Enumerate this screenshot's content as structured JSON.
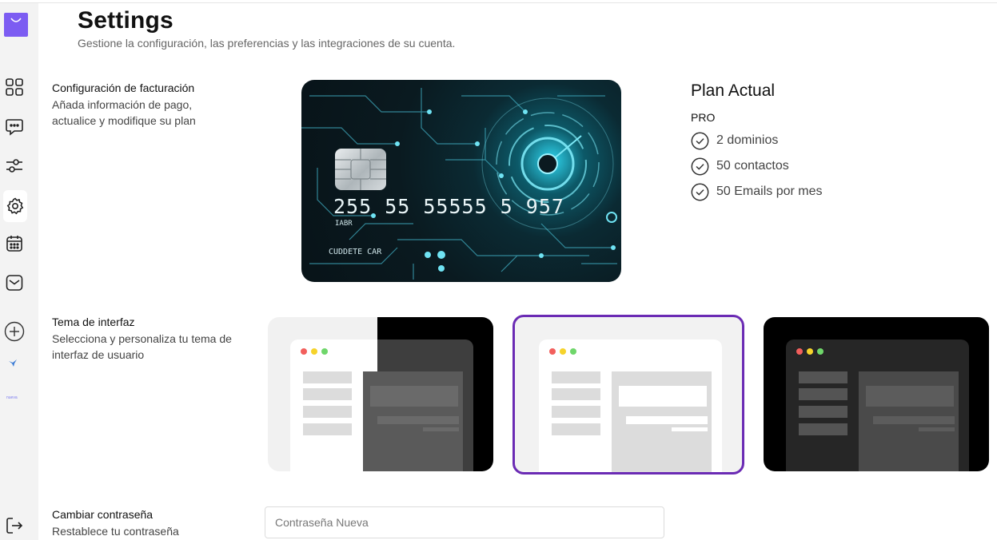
{
  "header": {
    "title": "Settings",
    "subtitle": "Gestione la configuración, las preferencias y las integraciones de su cuenta."
  },
  "sidebar": {
    "items": [
      {
        "icon": "dashboard-icon"
      },
      {
        "icon": "chat-icon"
      },
      {
        "icon": "sliders-icon"
      },
      {
        "icon": "gear-icon",
        "active": true
      },
      {
        "icon": "calendar-icon"
      },
      {
        "icon": "mail-icon"
      },
      {
        "icon": "plus-icon"
      }
    ],
    "tiny_label": "nueva",
    "logout_icon": "logout-icon"
  },
  "billing": {
    "title": "Configuración de facturación",
    "description": "Añada información de pago, actualice y modifique su plan",
    "card": {
      "number": "255 55  55555 5 957",
      "sub": "IABR",
      "name": "CUDDETE CAR"
    }
  },
  "plan": {
    "title": "Plan Actual",
    "name": "PRO",
    "features": [
      "2 dominios",
      "50 contactos",
      "50 Emails por mes"
    ]
  },
  "theme": {
    "title": "Tema de interfaz",
    "description": "Selecciona y personaliza tu tema de interfaz de usuario",
    "options": [
      "system",
      "light",
      "dark"
    ],
    "selected": "light"
  },
  "password": {
    "title": "Cambiar contraseña",
    "description": "Restablece tu contraseña",
    "placeholder": "Contraseña Nueva"
  },
  "colors": {
    "accent": "#7c5cf2",
    "selected_border": "#6b2bb4",
    "dot_red": "#f25f5c",
    "dot_yellow": "#f6d32b",
    "dot_green": "#6fd66a"
  }
}
